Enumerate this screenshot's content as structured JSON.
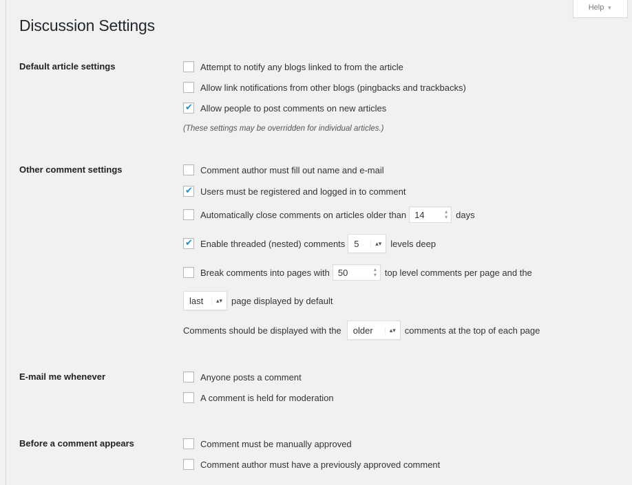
{
  "help_tab": {
    "label": "Help",
    "caret": "▼"
  },
  "page_title": "Discussion Settings",
  "sections": {
    "default_article": {
      "label": "Default article settings",
      "options": [
        {
          "label": "Attempt to notify any blogs linked to from the article",
          "checked": false
        },
        {
          "label": "Allow link notifications from other blogs (pingbacks and trackbacks)",
          "checked": false
        },
        {
          "label": "Allow people to post comments on new articles",
          "checked": true
        }
      ],
      "note": "(These settings may be overridden for individual articles.)"
    },
    "other_comment": {
      "label": "Other comment settings",
      "require_name_email": {
        "label": "Comment author must fill out name and e-mail",
        "checked": false
      },
      "registered_only": {
        "label": "Users must be registered and logged in to comment",
        "checked": true
      },
      "auto_close": {
        "prefix": "Automatically close comments on articles older than",
        "value": "14",
        "suffix": "days",
        "checked": false
      },
      "threaded": {
        "prefix": "Enable threaded (nested) comments",
        "value": "5",
        "suffix": "levels deep",
        "checked": true
      },
      "paginate": {
        "prefix": "Break comments into pages with",
        "value": "50",
        "suffix": "top level comments per page and the",
        "checked": false
      },
      "default_page": {
        "value": "last",
        "suffix": "page displayed by default"
      },
      "order": {
        "prefix": "Comments should be displayed with the",
        "value": "older",
        "suffix": "comments at the top of each page"
      }
    },
    "email_me": {
      "label": "E-mail me whenever",
      "options": [
        {
          "label": "Anyone posts a comment",
          "checked": false
        },
        {
          "label": "A comment is held for moderation",
          "checked": false
        }
      ]
    },
    "before_appears": {
      "label": "Before a comment appears",
      "options": [
        {
          "label": "Comment must be manually approved",
          "checked": false
        },
        {
          "label": "Comment author must have a previously approved comment",
          "checked": false
        }
      ]
    }
  },
  "colors": {
    "check": "#1e8cbe",
    "background": "#f1f1f1"
  }
}
